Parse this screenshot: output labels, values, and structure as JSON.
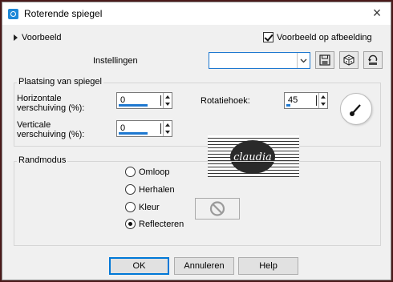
{
  "window": {
    "title": "Roterende spiegel"
  },
  "preview": {
    "label": "Voorbeeld",
    "show_label": "Voorbeeld op afbeelding",
    "show_checked": true
  },
  "settings": {
    "label": "Instellingen",
    "value": ""
  },
  "placement": {
    "title": "Plaatsing van spiegel",
    "h_offset": {
      "label_line1": "Horizontale",
      "label_line2": "verschuiving (%):",
      "value": "0"
    },
    "v_offset": {
      "label_line1": "Verticale",
      "label_line2": "verschuiving (%):",
      "value": "0"
    },
    "rotation": {
      "label": "Rotatiehoek:",
      "value": "45"
    }
  },
  "logo_text": "claudia",
  "edge_mode": {
    "title": "Randmodus",
    "options": [
      {
        "label": "Omloop",
        "selected": false
      },
      {
        "label": "Herhalen",
        "selected": false
      },
      {
        "label": "Kleur",
        "selected": false
      },
      {
        "label": "Reflecteren",
        "selected": true
      }
    ]
  },
  "buttons": {
    "ok": "OK",
    "cancel": "Annuleren",
    "help": "Help"
  },
  "colors": {
    "accent": "#1e78d0",
    "frame": "#4a1a1a",
    "window_bg": "#f0f0f0"
  }
}
